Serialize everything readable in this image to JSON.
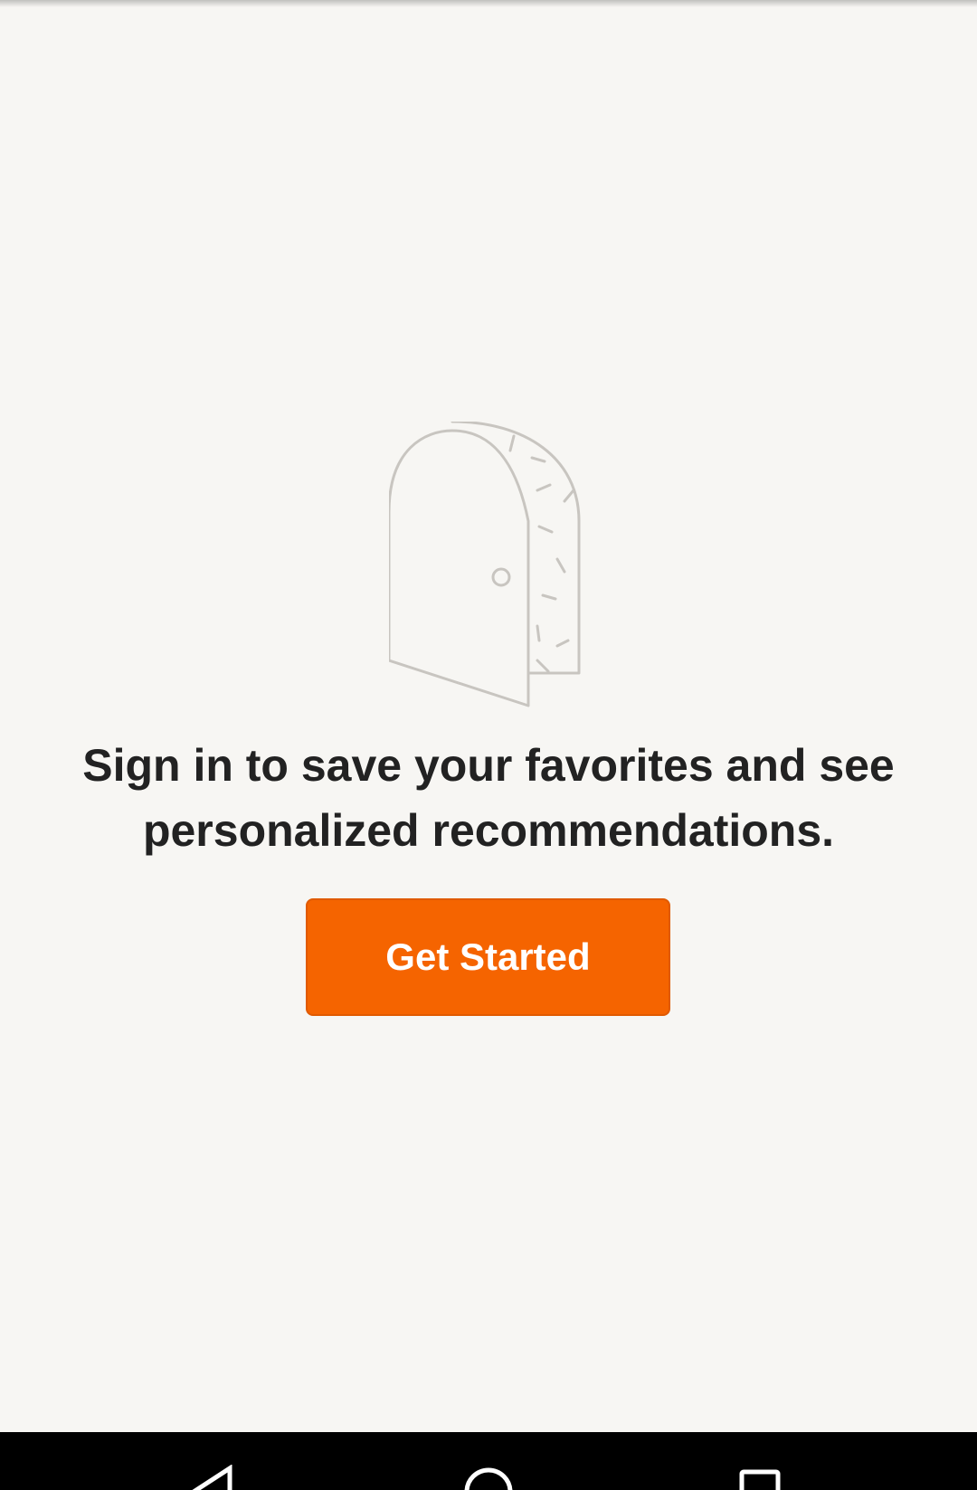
{
  "empty_state": {
    "message": "Sign in to save your favorites and see personalized recommendations.",
    "illustration_icon": "open-door-icon",
    "cta_label": "Get Started"
  },
  "colors": {
    "background": "#f7f6f3",
    "accent": "#f56400",
    "text": "#222222",
    "illustration_stroke": "#c8c5c0"
  },
  "system_nav": {
    "back_icon": "back-triangle-icon",
    "home_icon": "home-circle-icon",
    "recents_icon": "recents-square-icon"
  }
}
